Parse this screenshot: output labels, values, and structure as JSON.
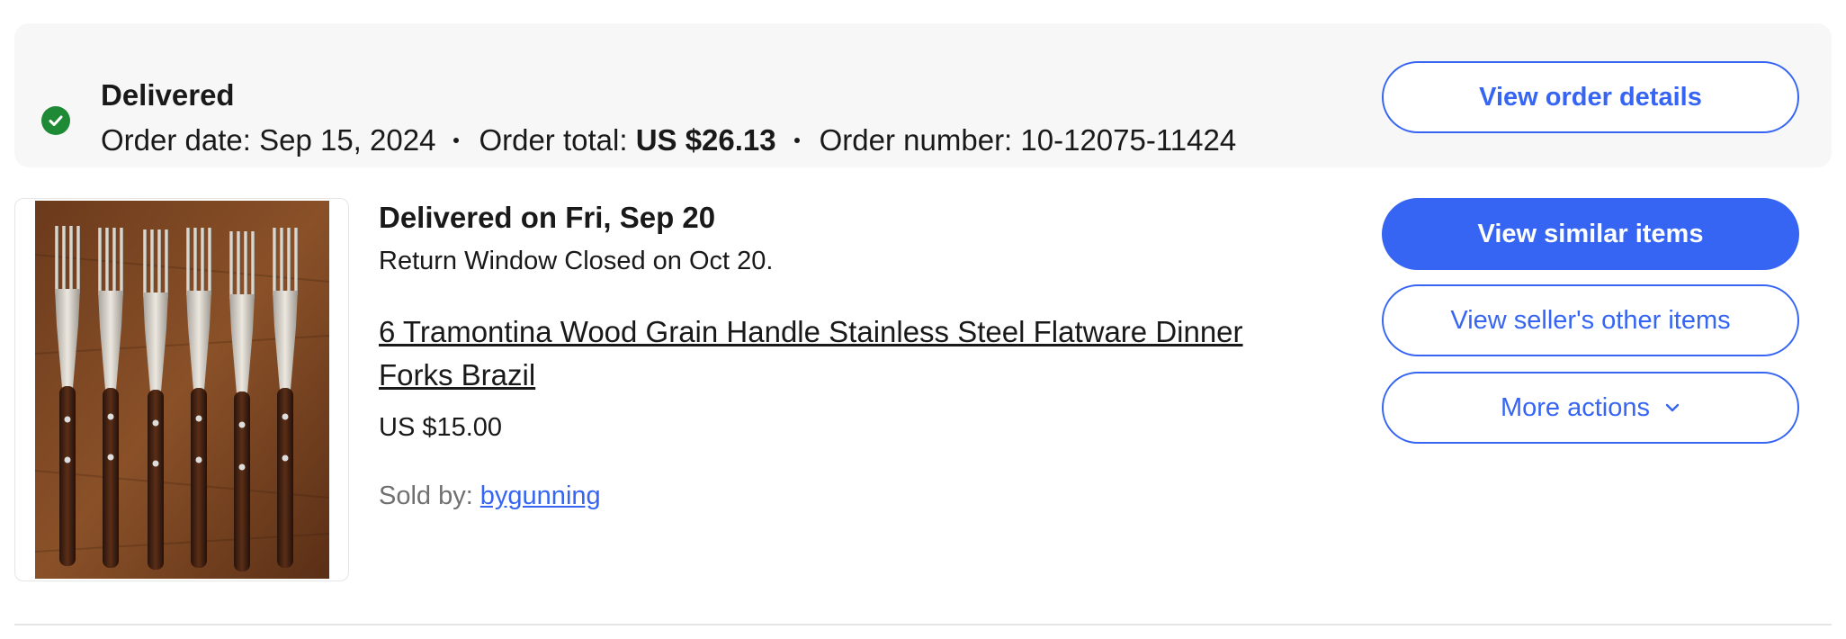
{
  "order": {
    "status": "Delivered",
    "order_date_label": "Order date:",
    "order_date": "Sep 15, 2024",
    "order_total_label": "Order total:",
    "order_total": "US $26.13",
    "order_number_label": "Order number:",
    "order_number": "10-12075-11424",
    "view_order_details": "View order details",
    "status_color": "#1e8a35"
  },
  "item": {
    "delivered_on": "Delivered on Fri, Sep 20",
    "return_window": "Return Window Closed on Oct 20.",
    "title": "6 Tramontina Wood Grain Handle Stainless Steel Flatware Dinner Forks Brazil",
    "price": "US $15.00",
    "sold_by_label": "Sold by:",
    "seller": "bygunning",
    "image_subject": "six forks with dark wood handles on wooden table"
  },
  "actions": {
    "view_similar": "View similar items",
    "view_seller_items": "View seller's other items",
    "more_actions": "More actions"
  },
  "colors": {
    "accent": "#3665f3",
    "header_bg": "#f7f7f7",
    "text": "#191919",
    "muted": "#707070"
  },
  "icons": [
    "check-circle-icon",
    "chevron-down-icon"
  ]
}
